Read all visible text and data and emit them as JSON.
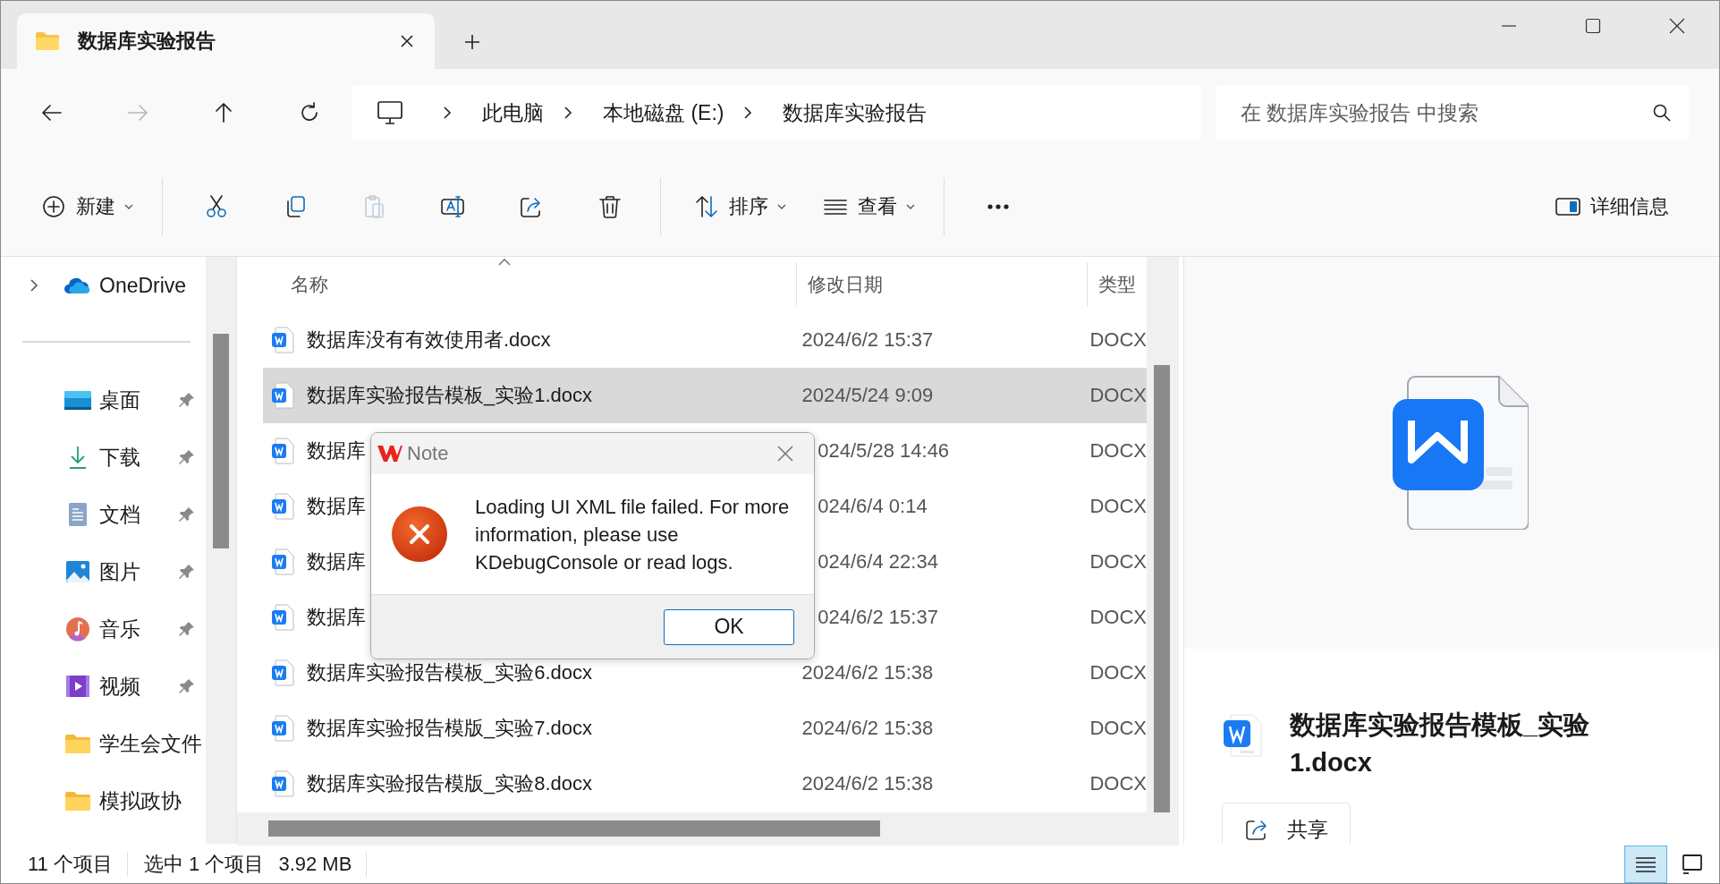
{
  "window": {
    "tab_title": "数据库实验报告"
  },
  "nav": [
    {
      "kind": "back",
      "disabled": false
    },
    {
      "kind": "forward",
      "disabled": true
    },
    {
      "kind": "up",
      "disabled": false
    },
    {
      "kind": "refresh",
      "disabled": false
    }
  ],
  "breadcrumbs": [
    "此电脑",
    "本地磁盘 (E:)",
    "数据库实验报告"
  ],
  "search": {
    "placeholder": "在 数据库实验报告 中搜索"
  },
  "toolbar": [
    {
      "kind": "new",
      "label": "新建",
      "disabled": false
    },
    {
      "kind": "cut",
      "disabled": false
    },
    {
      "kind": "copy",
      "disabled": false
    },
    {
      "kind": "paste",
      "disabled": true
    },
    {
      "kind": "rename",
      "disabled": false
    },
    {
      "kind": "share",
      "disabled": false
    },
    {
      "kind": "delete",
      "disabled": false
    },
    {
      "kind": "sort",
      "label": "排序",
      "disabled": false
    },
    {
      "kind": "view",
      "label": "查看",
      "disabled": false
    },
    {
      "kind": "more",
      "disabled": false
    }
  ],
  "details_button": {
    "label": "详细信息"
  },
  "sidebar": [
    {
      "kind": "onedrive",
      "label": "OneDrive",
      "pinned": false
    },
    {
      "kind": "desktop",
      "label": "桌面",
      "pinned": true
    },
    {
      "kind": "downloads",
      "label": "下载",
      "pinned": true
    },
    {
      "kind": "documents",
      "label": "文档",
      "pinned": true
    },
    {
      "kind": "pictures",
      "label": "图片",
      "pinned": true
    },
    {
      "kind": "music",
      "label": "音乐",
      "pinned": true
    },
    {
      "kind": "videos",
      "label": "视频",
      "pinned": true
    },
    {
      "kind": "folder",
      "label": "学生会文件",
      "pinned": false
    },
    {
      "kind": "folder",
      "label": "模拟政协",
      "pinned": false
    }
  ],
  "table": {
    "columns": [
      "名称",
      "修改日期",
      "类型"
    ],
    "rows": [
      {
        "name": "数据库没有有效使用者.docx",
        "modified": "2024/6/2 15:37",
        "type": "DOCX",
        "selected": false,
        "covered": false
      },
      {
        "name": "数据库实验报告模板_实验1.docx",
        "modified": "2024/5/24 9:09",
        "type": "DOCX",
        "selected": true,
        "covered": false
      },
      {
        "name": "数据库",
        "modified": "024/5/28 14:46",
        "type": "DOCX",
        "selected": false,
        "covered": true
      },
      {
        "name": "数据库",
        "modified": "024/6/4 0:14",
        "type": "DOCX",
        "selected": false,
        "covered": true
      },
      {
        "name": "数据库",
        "modified": "024/6/4 22:34",
        "type": "DOCX",
        "selected": false,
        "covered": true
      },
      {
        "name": "数据库",
        "modified": "024/6/2 15:37",
        "type": "DOCX",
        "selected": false,
        "covered": true
      },
      {
        "name": "数据库实验报告模板_实验6.docx",
        "modified": "2024/6/2 15:38",
        "type": "DOCX",
        "selected": false,
        "covered": false
      },
      {
        "name": "数据库实验报告模版_实验7.docx",
        "modified": "2024/6/2 15:38",
        "type": "DOCX",
        "selected": false,
        "covered": false
      },
      {
        "name": "数据库实验报告模版_实验8.docx",
        "modified": "2024/6/2 15:38",
        "type": "DOCX",
        "selected": false,
        "covered": false
      }
    ]
  },
  "preview": {
    "title": "数据库实验报告模板_实验1.docx",
    "share_label": "共享"
  },
  "dialog": {
    "title": "Note",
    "message": "Loading UI XML file failed. For more information, please use KDebugConsole or read logs.",
    "button": "OK"
  },
  "status_bar": {
    "item_count": "11 个项目",
    "selection": "选中 1 个项目",
    "size": "3.92 MB"
  },
  "view_toggle": [
    {
      "kind": "details",
      "selected": true
    },
    {
      "kind": "tiles",
      "selected": false
    }
  ]
}
